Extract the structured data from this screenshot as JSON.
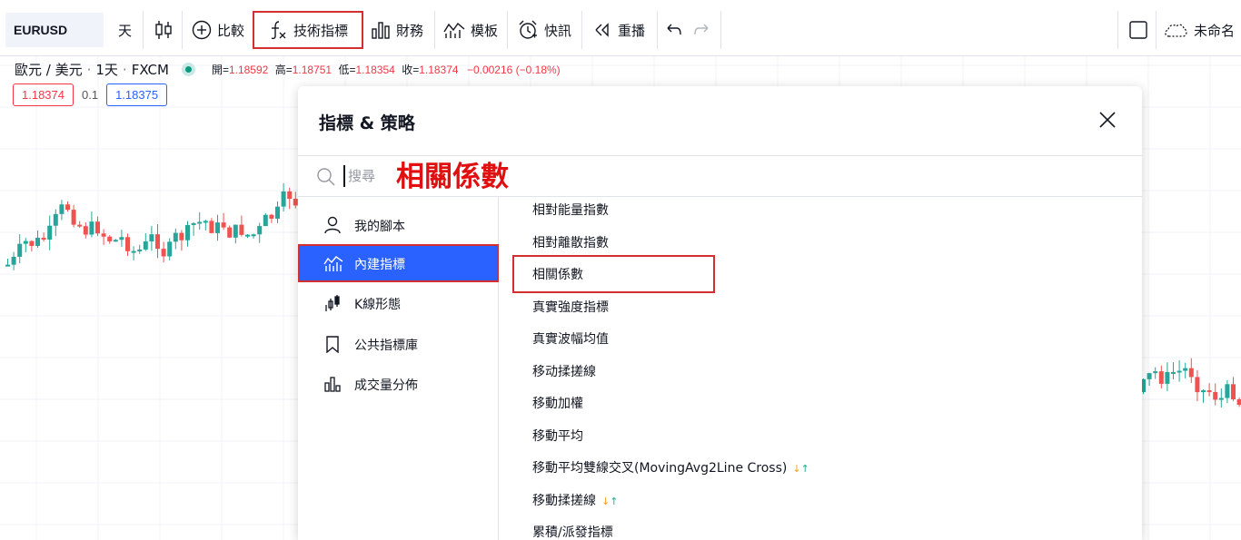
{
  "toolbar": {
    "symbol": "EURUSD",
    "interval": "天",
    "compare": "比較",
    "indicators": "技術指標",
    "financials": "財務",
    "templates": "模板",
    "alerts": "快訊",
    "replay": "重播",
    "layout_name": "未命名"
  },
  "legend": {
    "pair": "歐元 / 美元",
    "interval": "1天",
    "source": "FXCM",
    "open_label": "開=",
    "open": "1.18592",
    "high_label": "高=",
    "high": "1.18751",
    "low_label": "低=",
    "low": "1.18354",
    "close_label": "收=",
    "close": "1.18374",
    "change": "−0.00216 (−0.18%)",
    "sell_price": "1.18374",
    "spread": "0.1",
    "buy_price": "1.18375"
  },
  "colors": {
    "up": "#26a69a",
    "down": "#ef5350",
    "accent": "#2962ff",
    "highlight": "#d32f2f",
    "annotation": "#e01010"
  },
  "dialog": {
    "title": "指標 & 策略",
    "search_placeholder": "搜尋",
    "search_annotation": "相關係數",
    "sidebar": [
      {
        "label": "我的腳本",
        "icon": "user-icon"
      },
      {
        "label": "內建指標",
        "icon": "chart-line-icon",
        "active": true
      },
      {
        "label": "K線形態",
        "icon": "candles-icon"
      },
      {
        "label": "公共指標庫",
        "icon": "bookmark-icon"
      },
      {
        "label": "成交量分佈",
        "icon": "volume-profile-icon"
      }
    ],
    "items": [
      {
        "label": "相對能量指數"
      },
      {
        "label": "相對離散指數"
      },
      {
        "label": "相關係數",
        "highlighted": true
      },
      {
        "label": "真實強度指標"
      },
      {
        "label": "真實波幅均值"
      },
      {
        "label": "移动揉搓線"
      },
      {
        "label": "移動加權"
      },
      {
        "label": "移動平均"
      },
      {
        "label": "移動平均雙線交叉(MovingAvg2Line Cross)",
        "strategy": true
      },
      {
        "label": "移動揉搓線",
        "strategy": true
      },
      {
        "label": "累積/派發指標"
      }
    ]
  }
}
